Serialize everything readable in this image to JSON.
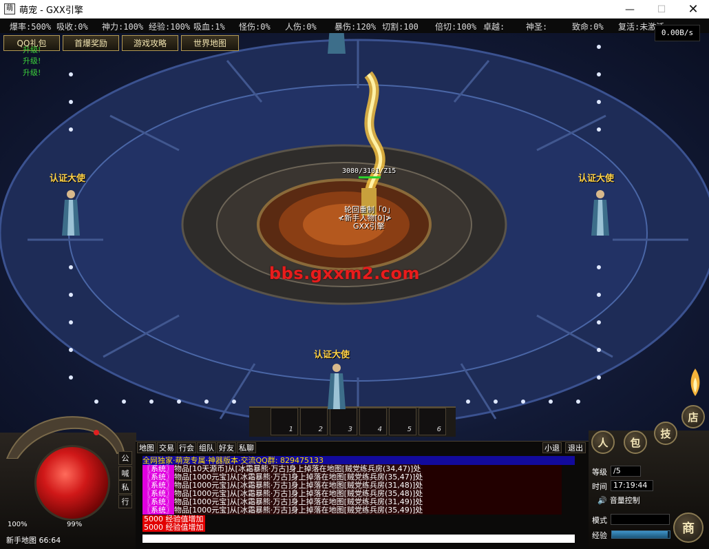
{
  "window": {
    "icon_text": "萌",
    "title": "萌宠 - GXX引擎"
  },
  "stats": [
    {
      "label": "爆率:500%"
    },
    {
      "label": "吸收:0%"
    },
    {
      "label": "神力:100%"
    },
    {
      "label": "经验:100%"
    },
    {
      "label": "吸血:1%"
    },
    {
      "label": "怪伤:0%"
    },
    {
      "label": "人伤:0%"
    },
    {
      "label": "暴伤:120%"
    },
    {
      "label": "切割:100"
    },
    {
      "label": "倍切:100%"
    },
    {
      "label": "卓越:"
    },
    {
      "label": "神圣:"
    },
    {
      "label": "致命:0%"
    },
    {
      "label": "复活:未激活"
    }
  ],
  "net_speed": "0.00B/s",
  "top_menu": {
    "gift": "QQ礼包",
    "first_drop": "首爆奖励",
    "strategy": "游戏攻略",
    "world_map": "世界地图"
  },
  "levelups": [
    "升级!",
    "升级!",
    "升级!"
  ],
  "npcs": {
    "left": "认证大使",
    "right": "认证大使",
    "bottom": "认证大使"
  },
  "player": {
    "hp": "3080/3101/Z15",
    "name_lines": [
      "轮回重制「0」",
      "≮新手人物[0]≯",
      "GXX引擎"
    ]
  },
  "watermark": "bbs.gxxm2.com",
  "hotbar": [
    "1",
    "2",
    "3",
    "4",
    "5",
    "6"
  ],
  "hud": {
    "hp_percent": "100%",
    "mp_percent": "99%",
    "map": "新手地图 66:64"
  },
  "side_tabs": [
    "公",
    "喊",
    "私",
    "行"
  ],
  "chat_tabs": {
    "map": "地图",
    "trade": "交易",
    "guild": "行会",
    "group": "组队",
    "friend": "好友",
    "private": "私聊",
    "logout": "小退",
    "exit": "退出"
  },
  "chat": {
    "header": "全网独家·萌宠专属·神器版本·交流QQ群: 829475133",
    "system_tag": "〖系统〗",
    "lines": [
      "物品[10天源币]从[冰霜暴熊·万古]身上掉落在地图[贼党练兵房(34,47)]处",
      "物品[1000元宝]从[冰霜暴熊·万古]身上掉落在地图[贼党练兵房(35,47)]处",
      "物品[1000元宝]从[冰霜暴熊·万古]身上掉落在地图[贼党练兵房(31,48)]处",
      "物品[1000元宝]从[冰霜暴熊·万古]身上掉落在地图[贼党练兵房(35,48)]处",
      "物品[1000元宝]从[冰霜暴熊·万古]身上掉落在地图[贼党练兵房(31,49)]处",
      "物品[1000元宝]从[冰霜暴熊·万古]身上掉落在地图[贼党练兵房(35,49)]处"
    ],
    "exp_lines": [
      "5000 经验值增加",
      "5000 经验值增加"
    ]
  },
  "right_panel": {
    "btn_person": "人",
    "btn_bag": "包",
    "btn_skill": "技",
    "btn_shop": "店",
    "btn_trade": "商",
    "level_label": "等级",
    "level_value": "/5",
    "time_label": "时间",
    "time_value": "17:19:44",
    "volume_label": "音量控制",
    "mode_label": "模式",
    "mode_value": "",
    "exp_label": "经验",
    "exp_fraction": 0.97
  }
}
